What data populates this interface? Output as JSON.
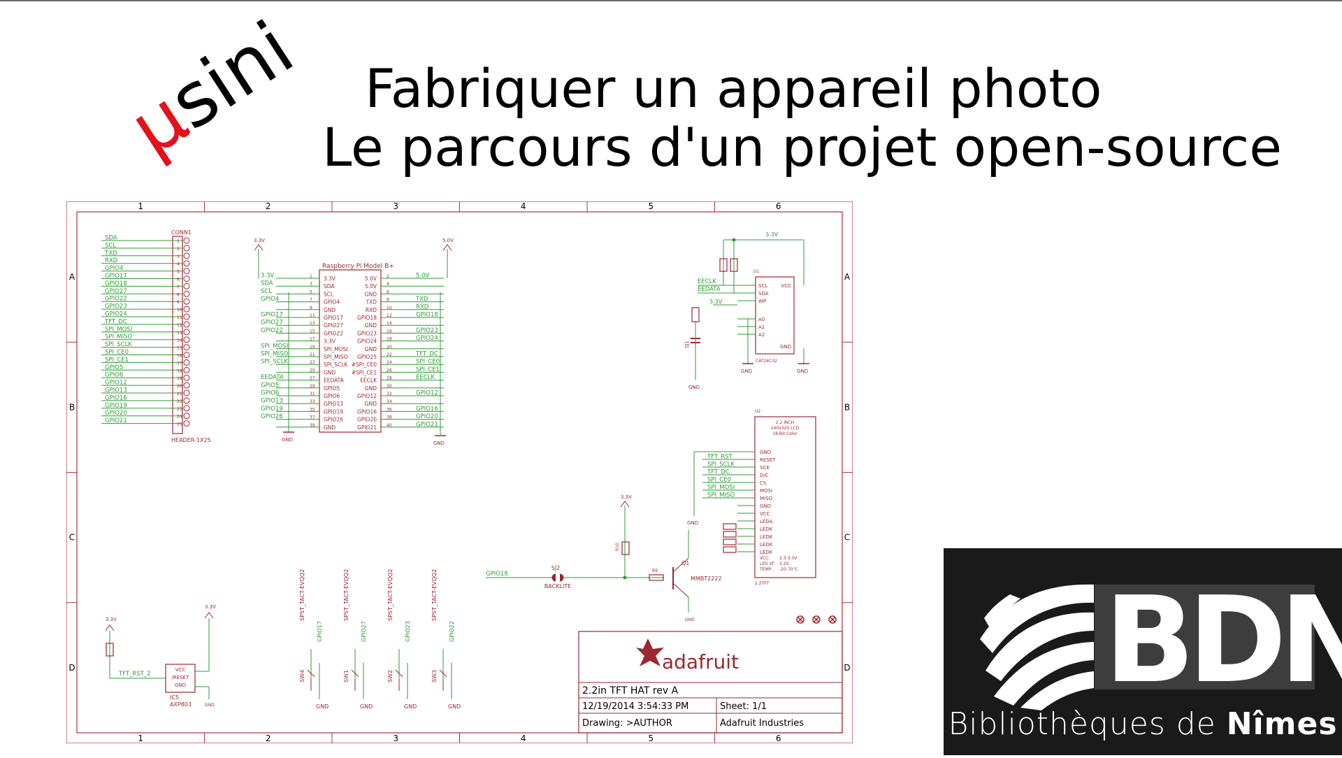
{
  "logo": {
    "mu": "µ",
    "text": "sini"
  },
  "title": {
    "line1": "Fabriquer un appareil photo",
    "line2": "Le parcours d'un projet open-source"
  },
  "schematic": {
    "frame_cols": [
      "1",
      "2",
      "3",
      "4",
      "5",
      "6"
    ],
    "frame_rows": [
      "A",
      "B",
      "C",
      "D"
    ],
    "conn1": {
      "name": "CONN1",
      "part": "HEADER-1X25",
      "signals": [
        "SDA",
        "SCL",
        "TXD",
        "RXD",
        "GPIO4",
        "GPIO17",
        "GPIO18",
        "GPIO27",
        "GPIO22",
        "GPIO23",
        "GPIO24",
        "TFT_DC",
        "SPI_MOSI",
        "SPI_MISO",
        "SPI_SCLK",
        "SPI_CE0",
        "SPI_CE1",
        "GPIO5",
        "GPIO6",
        "GPIO12",
        "GPIO13",
        "GPIO16",
        "GPIO19",
        "GPIO20",
        "GPIO21"
      ]
    },
    "rpi": {
      "title": "Raspberry Pi Model B+",
      "left_pins": [
        "3.3V",
        "SDA",
        "SCL",
        "GPIO4",
        "GND",
        "GPIO17",
        "GPIO27",
        "GPIO22",
        "3.3V",
        "SPI_MOSI",
        "SPI_MISO",
        "SPI_SCLK",
        "GND",
        "EEDATA",
        "GPIO5",
        "GPIO6",
        "GPIO13",
        "GPIO19",
        "GPIO26",
        "GND"
      ],
      "right_pins": [
        "5.0V",
        "5.0V",
        "GND",
        "TXD",
        "RXD",
        "GPIO18",
        "GND",
        "GPIO23",
        "GPIO24",
        "GND",
        "GPIO25",
        "#SPI_CE0",
        "#SPI_CE1",
        "EECLK",
        "GND",
        "GPIO12",
        "GND",
        "GPIO16",
        "GPIO20",
        "GPIO21"
      ],
      "left_nets": [
        "3.3V",
        "SDA",
        "SCL",
        "GPIO4",
        "",
        "GPIO17",
        "GPIO27",
        "GPIO22",
        "",
        "SPI_MOSI",
        "SPI_MISO",
        "SPI_SCLK",
        "",
        "EEDATA",
        "GPIO5",
        "GPIO6",
        "GPIO13",
        "GPIO19",
        "GPIO26",
        ""
      ],
      "right_nets": [
        "5.0V",
        "",
        "",
        "TXD",
        "RXD",
        "GPIO18",
        "",
        "GPIO23",
        "GPIO24",
        "",
        "TFT_DC",
        "SPI_CE0",
        "SPI_CE1",
        "EECLK",
        "",
        "GPIO12",
        "",
        "GPIO16",
        "GPIO20",
        "GPIO21"
      ],
      "power_left": "3.3V",
      "power_right": "5.0V",
      "gnd": "GND"
    },
    "eeprom": {
      "ref": "U1",
      "part": "CAT24C32",
      "pins_left": [
        "SCL",
        "SDA",
        "WP",
        "A0",
        "A1",
        "A2"
      ],
      "pins_right": [
        "VCC",
        "GND"
      ],
      "nets": [
        "EECLK",
        "EEDATA"
      ],
      "supply": "3.3V",
      "gnd": "GND",
      "jumper": "SJ1"
    },
    "lcd": {
      "ref": "U2",
      "header": [
        "2.2 INCH",
        "240x320 LCD",
        "18-Bit Color"
      ],
      "pins": [
        "GND",
        "RESET",
        "SCK",
        "D/C",
        "CS",
        "MOSI",
        "MISO",
        "GND",
        "VCC",
        "LEDA",
        "LEDK",
        "LEDK",
        "LEDK",
        "LEDK"
      ],
      "nets": [
        "TFT_RST",
        "SPI_SCLK",
        "TFT_DC",
        "SPI_CE0",
        "SPI_MOSI",
        "SPI_MISO"
      ],
      "specs": [
        "VCC:",
        "2.3-3.3V",
        "LED Vf:",
        "3.2V",
        "TEMP:",
        "-20-70°C"
      ],
      "part": "2.2TFT",
      "gnd": "GND"
    },
    "backlight": {
      "net": "GPIO18",
      "jumper": "SJ2",
      "label": "BACKLITE",
      "transistor_ref": "Q1",
      "transistor": "MMBT2222",
      "r_base": "R9",
      "r_pull": "R10",
      "supply": "3.3V",
      "gnd": "GND"
    },
    "reset_ic": {
      "ref": "IC5",
      "part": "AXP803",
      "pins": [
        "VCC",
        "/RESET",
        "GND"
      ],
      "net": "TFT_RST_2",
      "supply": "3.3V",
      "gnd": "GND"
    },
    "switches": [
      {
        "ref": "SW4",
        "part": "SPST_TACT-EVQQ2",
        "net": "GPIO17",
        "gnd": "GND"
      },
      {
        "ref": "SW1",
        "part": "SPST_TACT-EVQQ2",
        "net": "GPIO27",
        "gnd": "GND"
      },
      {
        "ref": "SW2",
        "part": "SPST_TACT-EVQQ2",
        "net": "GPIO23",
        "gnd": "GND"
      },
      {
        "ref": "SW3",
        "part": "SPST_TACT-EVQQ2",
        "net": "GPIO22",
        "gnd": "GND"
      }
    ],
    "title_block": {
      "brand": "adafruit",
      "board": "2.2in TFT HAT rev A",
      "date": "12/19/2014 3:54:33 PM",
      "sheet": "Sheet: 1/1",
      "drawing": "Drawing: >AUTHOR",
      "company": "Adafruit Industries"
    },
    "colors": {
      "frame": "#b0303a",
      "wire": "#2f9a34",
      "part": "#9b2730",
      "junction": "#2f9a34"
    }
  },
  "bdn": {
    "letters": "BDN",
    "caption_pre": "Bibliothèques de ",
    "caption_bold": "Nîmes"
  }
}
